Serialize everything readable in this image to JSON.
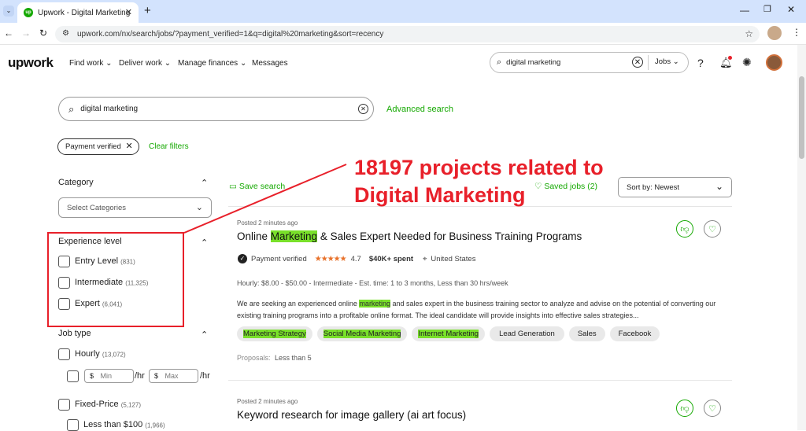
{
  "browser": {
    "tab_title": "Upwork - Digital Marketing",
    "tab_favicon": "up",
    "url": "upwork.com/nx/search/jobs/?payment_verified=1&q=digital%20marketing&sort=recency"
  },
  "header": {
    "logo": "upwork",
    "nav": [
      "Find work",
      "Deliver work",
      "Manage finances",
      "Messages"
    ],
    "search_value": "digital marketing",
    "search_scope": "Jobs"
  },
  "search": {
    "value": "digital marketing",
    "advanced": "Advanced search"
  },
  "filters": {
    "chip": "Payment verified",
    "clear": "Clear filters"
  },
  "sidebar": {
    "category_title": "Category",
    "category_select": "Select Categories",
    "experience_title": "Experience level",
    "experience": [
      {
        "label": "Entry Level",
        "count": "(831)"
      },
      {
        "label": "Intermediate",
        "count": "(11,325)"
      },
      {
        "label": "Expert",
        "count": "(6,041)"
      }
    ],
    "jobtype_title": "Job type",
    "hourly": {
      "label": "Hourly",
      "count": "(13,072)",
      "min_currency": "$",
      "min_placeholder": "Min",
      "max_currency": "$",
      "max_placeholder": "Max",
      "unit": "/hr"
    },
    "fixed": {
      "label": "Fixed-Price",
      "count": "(5,127)"
    },
    "less_than": {
      "label": "Less than $100",
      "count": "(1,966)"
    }
  },
  "results": {
    "save_search": "Save search",
    "saved_jobs": "Saved jobs (2)",
    "sort": "Sort by: Newest"
  },
  "annotation": {
    "text_line1": "18197 projects related to",
    "text_line2": "Digital Marketing",
    "color": "#e8202a"
  },
  "jobs": [
    {
      "posted": "Posted 2 minutes ago",
      "title_pre": "Online ",
      "title_hl": "Marketing",
      "title_post": " & Sales Expert Needed for Business Training Programs",
      "payment": "Payment verified",
      "rating": "4.7",
      "spent": "$40K+ spent",
      "location": "United States",
      "meta": "Hourly: $8.00 - $50.00 - Intermediate - Est. time: 1 to 3 months, Less than 30 hrs/week",
      "desc_pre": "We are seeking an experienced online ",
      "desc_hl": "marketing",
      "desc_post": " and sales expert in the business training sector to analyze and advise on the potential of converting our existing training programs into a profitable online format. The ideal candidate will provide insights into effective sales strategies...",
      "tags": [
        {
          "text": "Marketing Strategy",
          "hl": true
        },
        {
          "text": "Social Media Marketing",
          "hl": true
        },
        {
          "text": "Internet Marketing",
          "hl": true
        },
        {
          "text": "Lead Generation",
          "hl": false
        },
        {
          "text": "Sales",
          "hl": false
        },
        {
          "text": "Facebook",
          "hl": false
        }
      ],
      "proposals_label": "Proposals:",
      "proposals_value": "Less than 5"
    },
    {
      "posted": "Posted 2 minutes ago",
      "title": "Keyword research for image gallery (ai art focus)"
    }
  ]
}
